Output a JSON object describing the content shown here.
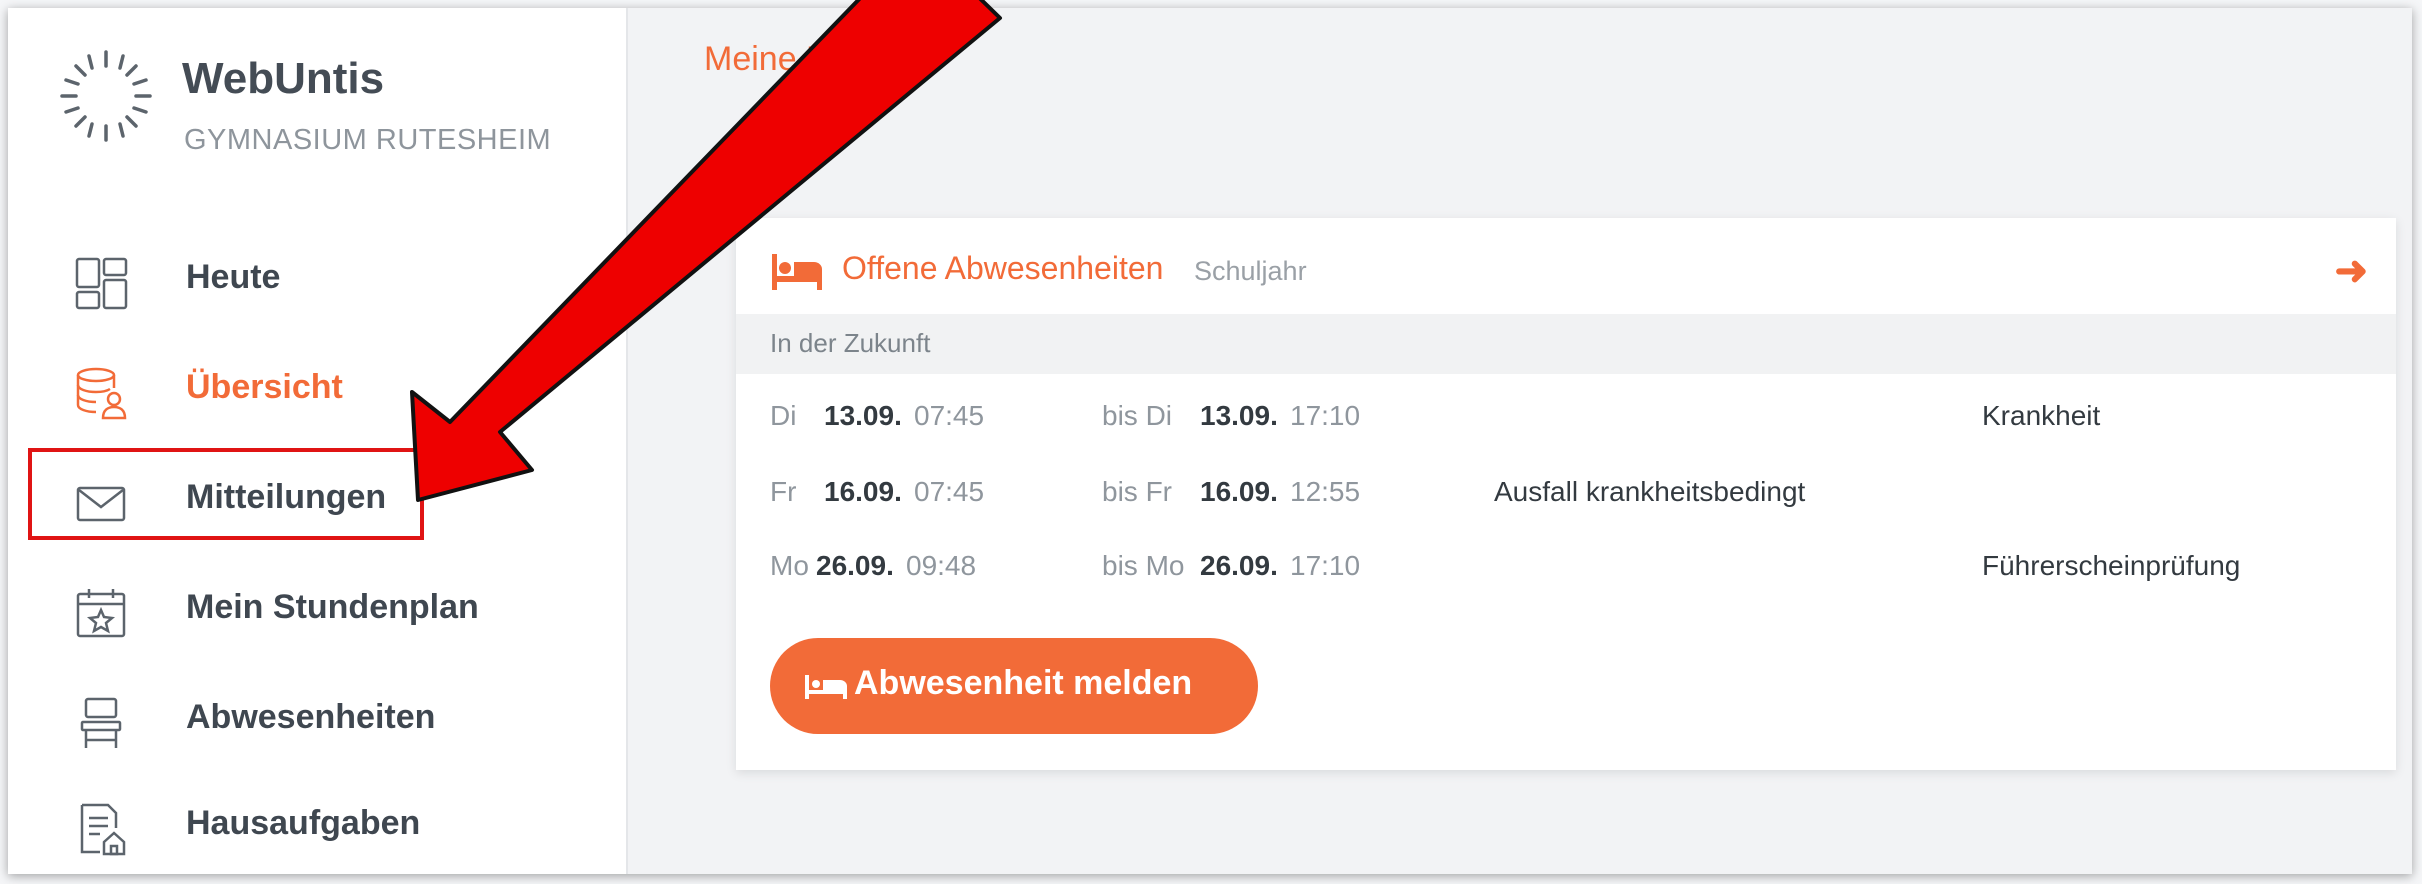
{
  "brand": {
    "title": "WebUntis",
    "school": "GYMNASIUM RUTESHEIM"
  },
  "nav": {
    "items": [
      {
        "label": "Heute",
        "icon": "dashboard-icon"
      },
      {
        "label": "Übersicht",
        "icon": "database-user-icon",
        "active": true
      },
      {
        "label": "Mitteilungen",
        "icon": "envelope-icon"
      },
      {
        "label": "Mein Stundenplan",
        "icon": "calendar-star-icon"
      },
      {
        "label": "Abwesenheiten",
        "icon": "chair-icon"
      },
      {
        "label": "Hausaufgaben",
        "icon": "homework-icon"
      }
    ]
  },
  "main": {
    "header": "Meine Dat"
  },
  "card": {
    "title": "Offene Abwesenheiten",
    "subtitle": "Schuljahr",
    "section_label": "In der Zukunft",
    "rows": [
      {
        "day": "Di",
        "date": "13.09.",
        "time": "07:45",
        "bis_day": "bis Di",
        "end_date": "13.09.",
        "end_time": "17:10",
        "reason": "",
        "category": "Krankheit"
      },
      {
        "day": "Fr",
        "date": "16.09.",
        "time": "07:45",
        "bis_day": "bis Fr",
        "end_date": "16.09.",
        "end_time": "12:55",
        "reason": "Ausfall krankheitsbedingt",
        "category": ""
      },
      {
        "day": "Mo",
        "date": "26.09.",
        "time": "09:48",
        "bis_day": "bis Mo",
        "end_date": "26.09.",
        "end_time": "17:10",
        "reason": "",
        "category": "Führerscheinprüfung"
      }
    ],
    "button_label": "Abwesenheit melden"
  },
  "colors": {
    "accent": "#f26b38",
    "highlight": "#e01414",
    "arrow": "#ee0000"
  }
}
